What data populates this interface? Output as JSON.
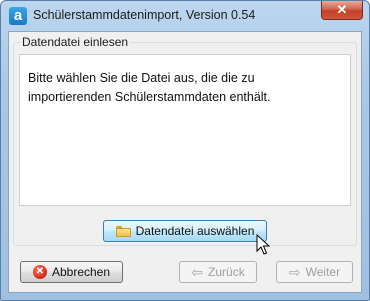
{
  "window": {
    "app_icon_letter": "a",
    "title": "Schülerstammdatenimport, Version 0.54",
    "close_symbol": "✕"
  },
  "group": {
    "legend": "Datendatei einlesen",
    "info_text": "Bitte wählen Sie die Datei aus, die die zu importierenden Schülerstammdaten enthält."
  },
  "buttons": {
    "choose_file": {
      "label": "Datendatei auswählen",
      "icon": "folder-icon",
      "state": "hover"
    },
    "cancel": {
      "label": "Abbrechen",
      "icon": "cancel-icon",
      "icon_glyph": "✕"
    },
    "back": {
      "label": "Zurück",
      "icon": "arrow-left-icon",
      "icon_glyph": "⇦",
      "state": "disabled"
    },
    "next": {
      "label": "Weiter",
      "icon": "arrow-right-icon",
      "icon_glyph": "⇨",
      "state": "disabled"
    }
  },
  "colors": {
    "title_bar": "#a9c8e6",
    "close_button": "#c24128",
    "client_background": "#f0f0f0",
    "hover_button_border": "#3c7fb1"
  }
}
